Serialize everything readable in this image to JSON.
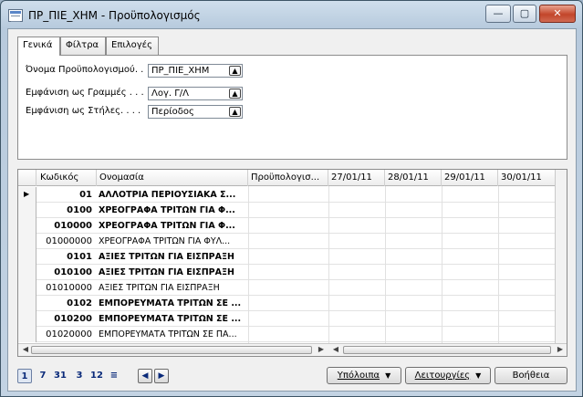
{
  "window": {
    "title": "ΠΡ_ΠΙΕ_ΧΗΜ - Προϋπολογισμός",
    "controls": {
      "minimize": "—",
      "maximize": "▢",
      "close": "✕"
    }
  },
  "tabs": [
    {
      "label": "Γενικά",
      "active": true
    },
    {
      "label": "Φίλτρα",
      "active": false
    },
    {
      "label": "Επιλογές",
      "active": false
    }
  ],
  "form": {
    "budget": {
      "label": "Όνομα Προϋπολογισμού. . . .",
      "value": "ΠΡ_ΠΙΕ_ΧΗΜ"
    },
    "rows_as": {
      "label": "Εμφάνιση ως Γραμμές . . . . .",
      "value": "Λογ. Γ/Λ"
    },
    "cols_as": {
      "label": "Εμφάνιση ως Στήλες. . . . . .",
      "value": "Περίοδος"
    }
  },
  "grid": {
    "columns": [
      "Κωδικός",
      "Ονομασία",
      "Προϋπολογισ...",
      "27/01/11",
      "28/01/11",
      "29/01/11",
      "30/01/11"
    ],
    "rows": [
      {
        "code": "01",
        "name": "ΑΛΛΟΤΡΙΑ ΠΕΡΙΟΥΣΙΑΚΑ Σ...",
        "bold": true,
        "current": true
      },
      {
        "code": "0100",
        "name": "ΧΡΕΟΓΡΑΦΑ ΤΡΙΤΩΝ ΓΙΑ Φ...",
        "bold": true,
        "current": false
      },
      {
        "code": "010000",
        "name": "ΧΡΕΟΓΡΑΦΑ ΤΡΙΤΩΝ ΓΙΑ Φ...",
        "bold": true,
        "current": false
      },
      {
        "code": "01000000",
        "name": "ΧΡΕΟΓΡΑΦΑ ΤΡΙΤΩΝ ΓΙΑ ΦΥΛ...",
        "bold": false,
        "current": false
      },
      {
        "code": "0101",
        "name": "ΑΞΙΕΣ ΤΡΙΤΩΝ ΓΙΑ ΕΙΣΠΡΑΞΗ",
        "bold": true,
        "current": false
      },
      {
        "code": "010100",
        "name": "ΑΞΙΕΣ ΤΡΙΤΩΝ ΓΙΑ ΕΙΣΠΡΑΞΗ",
        "bold": true,
        "current": false
      },
      {
        "code": "01010000",
        "name": "ΑΞΙΕΣ ΤΡΙΤΩΝ ΓΙΑ ΕΙΣΠΡΑΞΗ",
        "bold": false,
        "current": false
      },
      {
        "code": "0102",
        "name": "ΕΜΠΟΡΕΥΜΑΤΑ ΤΡΙΤΩΝ ΣΕ ...",
        "bold": true,
        "current": false
      },
      {
        "code": "010200",
        "name": "ΕΜΠΟΡΕΥΜΑΤΑ ΤΡΙΤΩΝ ΣΕ ...",
        "bold": true,
        "current": false
      },
      {
        "code": "01020000",
        "name": "ΕΜΠΟΡΕΥΜΑΤΑ ΤΡΙΤΩΝ ΣΕ ΠΑ...",
        "bold": false,
        "current": false
      }
    ]
  },
  "pager": {
    "items": [
      "1",
      "7",
      "31",
      "3",
      "12",
      "≡"
    ],
    "current": "1"
  },
  "buttons": {
    "balances": "Υπόλοιπα",
    "functions": "Λειτουργίες",
    "help": "Βοήθεια"
  }
}
